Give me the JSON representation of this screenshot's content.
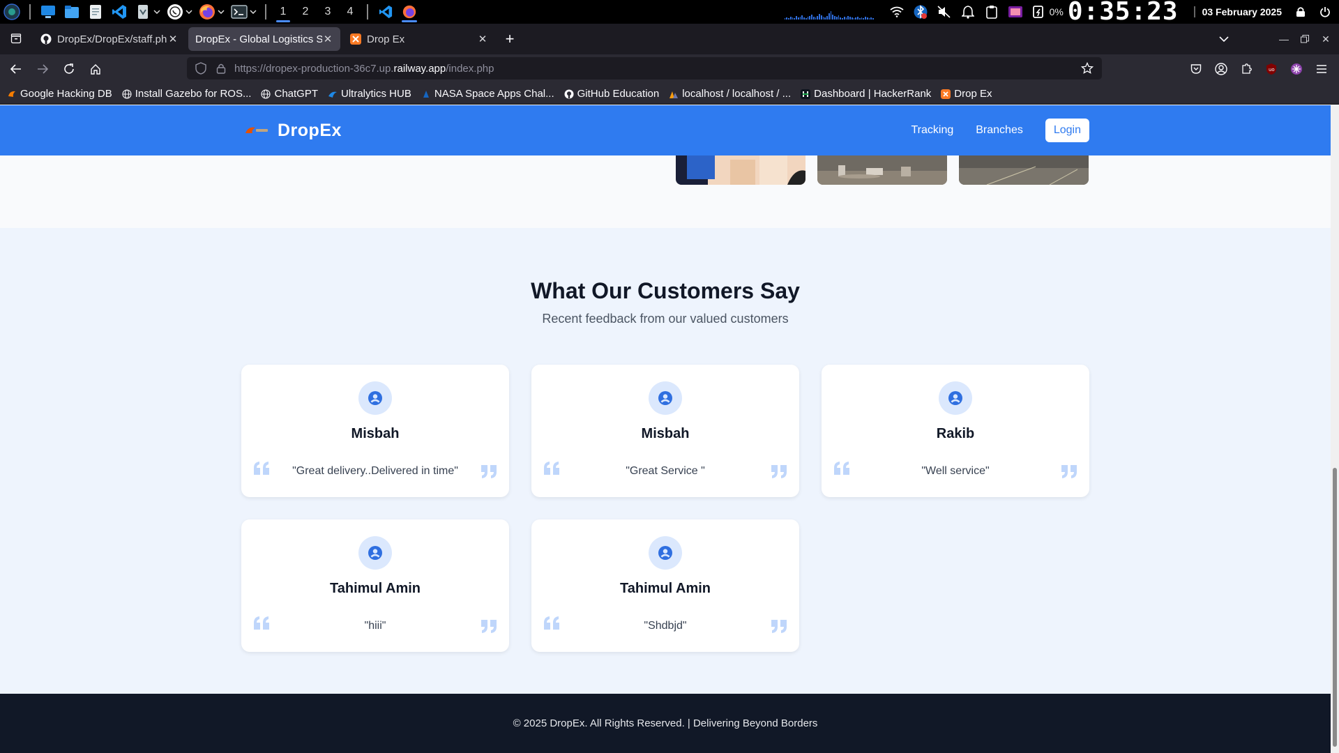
{
  "os": {
    "workspaces": [
      "1",
      "2",
      "3",
      "4"
    ],
    "active_workspace": "1",
    "battery_pct": "0%",
    "clock": "0:35:23",
    "date": "03 February 2025"
  },
  "browser": {
    "tabs": [
      {
        "title": "DropEx/DropEx/staff.php",
        "active": false
      },
      {
        "title": "DropEx - Global Logistics Solutions",
        "active": true
      },
      {
        "title": "Drop Ex",
        "active": false
      }
    ],
    "url": {
      "prefix": "https://dropex-production-36c7.up.",
      "domain": "railway.app",
      "path": "/index.php"
    },
    "bookmarks": [
      "Google Hacking DB",
      "Install Gazebo for ROS...",
      "ChatGPT",
      "Ultralytics HUB",
      "NASA Space Apps Chal...",
      "GitHub Education",
      "localhost / localhost / ...",
      "Dashboard | HackerRank",
      "Drop Ex"
    ]
  },
  "site": {
    "brand": "DropEx",
    "nav": {
      "tracking": "Tracking",
      "branches": "Branches",
      "login": "Login"
    },
    "testimonials": {
      "title": "What Our Customers Say",
      "subtitle": "Recent feedback from our valued customers",
      "items": [
        {
          "name": "Misbah",
          "quote": "\"Great delivery..Delivered in time\""
        },
        {
          "name": "Misbah",
          "quote": "\"Great Service \""
        },
        {
          "name": "Rakib",
          "quote": "\"Well service\""
        },
        {
          "name": "Tahimul Amin",
          "quote": "\"hiii\""
        },
        {
          "name": "Tahimul Amin",
          "quote": "\"Shdbjd\""
        }
      ]
    },
    "footer": "© 2025 DropEx. All Rights Reserved. | Delivering Beyond Borders"
  },
  "colors": {
    "brand_blue": "#2f7bf0",
    "section_bg": "#eef4fd",
    "footer_bg": "#111827",
    "quote_mark": "#bfd6fb",
    "avatar_bg": "#dbe8fd"
  }
}
